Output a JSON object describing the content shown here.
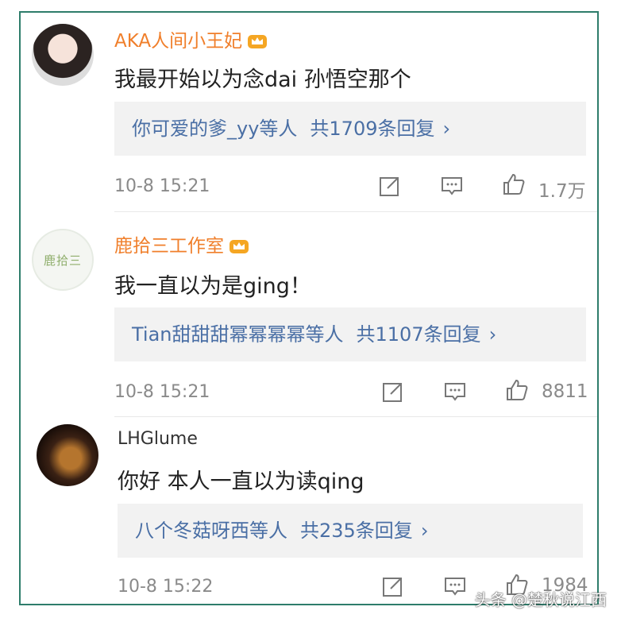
{
  "comments": [
    {
      "username": "AKA人间小王妃",
      "text": "我最开始以为念dai 孙悟空那个",
      "reply_users": "你可爱的爹_yy等人",
      "reply_count": "共1709条回复",
      "time": "10-8 15:21",
      "likes": "1.7万"
    },
    {
      "username": "鹿拾三工作室",
      "avatar_text": "鹿拾三",
      "text": "我一直以为是ging！",
      "reply_users": "Tian甜甜甜幂幂幂幂等人",
      "reply_count": "共1107条回复",
      "time": "10-8 15:21",
      "likes": "8811"
    },
    {
      "username": "LHGlume",
      "text": "你好 本人一直以为读qing",
      "reply_users": "八个冬菇呀西等人",
      "reply_count": "共235条回复",
      "time": "10-8 15:22",
      "likes": "1984"
    }
  ],
  "chevron": "›",
  "watermark": "头条 @楚秋说江西",
  "colors": {
    "username": "#f07f2b",
    "link": "#4a6fa5",
    "frame": "#2e7d6b"
  },
  "icons": [
    "crown-badge-icon",
    "share-icon",
    "comment-icon",
    "like-icon"
  ]
}
